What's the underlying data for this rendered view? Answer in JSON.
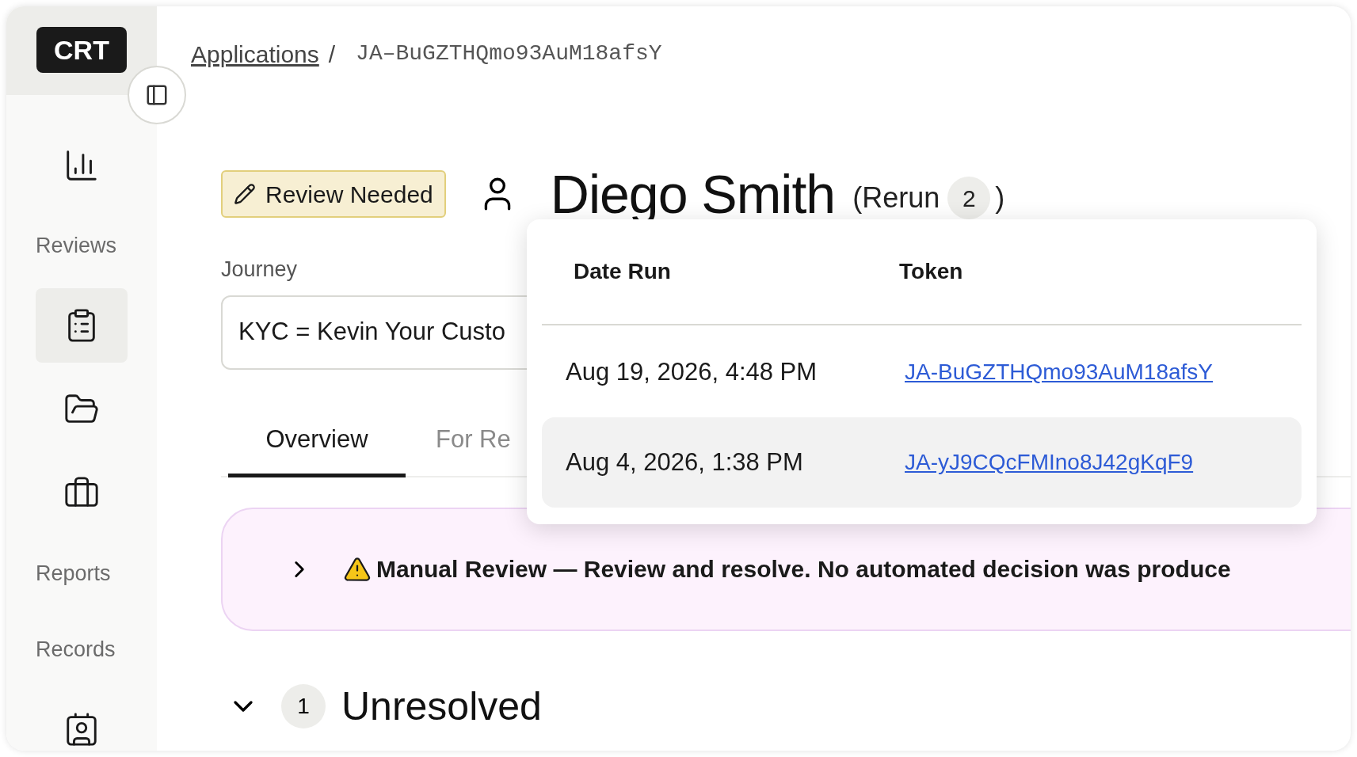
{
  "sidebar": {
    "logo": "CRT",
    "items": [
      {
        "kind": "button",
        "selected": false
      },
      {
        "kind": "heading",
        "label": "Reviews"
      },
      {
        "kind": "button",
        "selected": true
      },
      {
        "kind": "button",
        "selected": false
      },
      {
        "kind": "button",
        "selected": false
      },
      {
        "kind": "heading",
        "label": "Reports"
      },
      {
        "kind": "heading",
        "label": "Records"
      },
      {
        "kind": "button",
        "selected": false
      }
    ]
  },
  "breadcrumb": {
    "link": "Applications",
    "separator": "/",
    "current": "JA–BuGZTHQmo93AuM18afsY"
  },
  "header": {
    "status": "Review Needed",
    "name": "Diego Smith",
    "rerun_label": "(Rerun",
    "rerun_count": "2",
    "rerun_close": ")"
  },
  "journey": {
    "label": "Journey",
    "value": "KYC = Kevin Your Custo"
  },
  "tabs": [
    {
      "label": "Overview",
      "selected": true
    },
    {
      "label": "For Re",
      "selected": false
    }
  ],
  "banner": {
    "text": "Manual Review — Review and resolve. No automated decision was produce",
    "expanded": false
  },
  "section": {
    "count": "1",
    "title": "Unresolved",
    "expanded": true
  },
  "popover": {
    "columns": [
      "Date Run",
      "Token"
    ],
    "rows": [
      {
        "date": "Aug 19, 2026, 4:48 PM",
        "token": "JA-BuGZTHQmo93AuM18afsY",
        "selected": false
      },
      {
        "date": "Aug 4, 2026, 1:38 PM",
        "token": "JA-yJ9CQcFMIno8J42gKqF9",
        "selected": true
      }
    ]
  }
}
